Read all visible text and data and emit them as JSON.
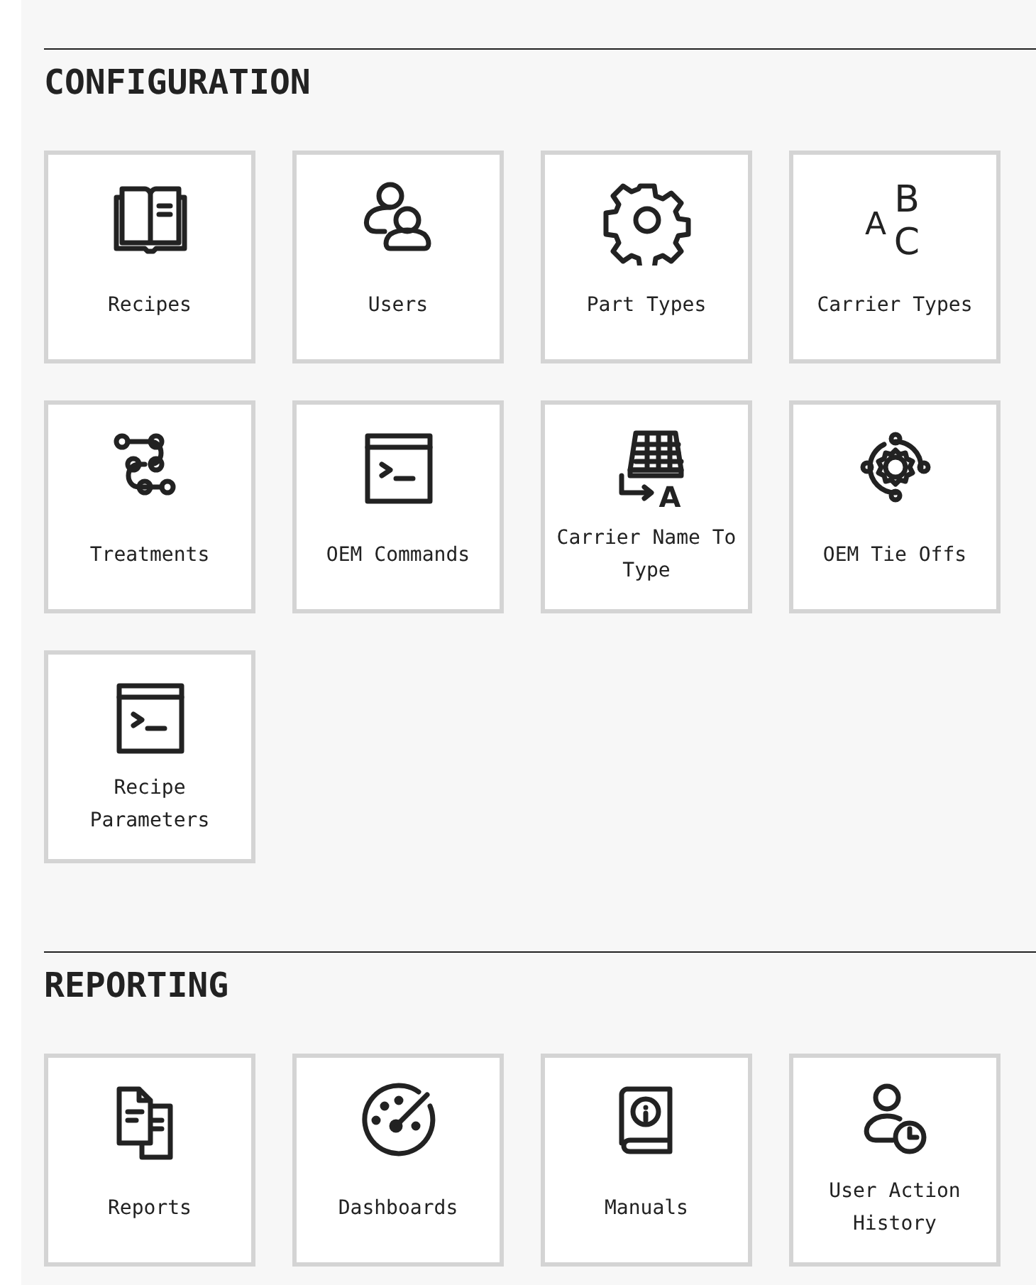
{
  "sections": [
    {
      "title": "CONFIGURATION",
      "tiles": [
        {
          "label": "Recipes"
        },
        {
          "label": "Users"
        },
        {
          "label": "Part Types"
        },
        {
          "label": "Carrier Types",
          "icon_letters": [
            "A",
            "B",
            "C"
          ]
        },
        {
          "label": "Treatments"
        },
        {
          "label": "OEM Commands"
        },
        {
          "label": "Carrier Name To Type",
          "icon_letters": [
            "A"
          ]
        },
        {
          "label": "OEM Tie Offs"
        },
        {
          "label": "Recipe Parameters"
        }
      ]
    },
    {
      "title": "REPORTING",
      "tiles": [
        {
          "label": "Reports"
        },
        {
          "label": "Dashboards"
        },
        {
          "label": "Manuals"
        },
        {
          "label": "User Action History"
        }
      ]
    }
  ]
}
